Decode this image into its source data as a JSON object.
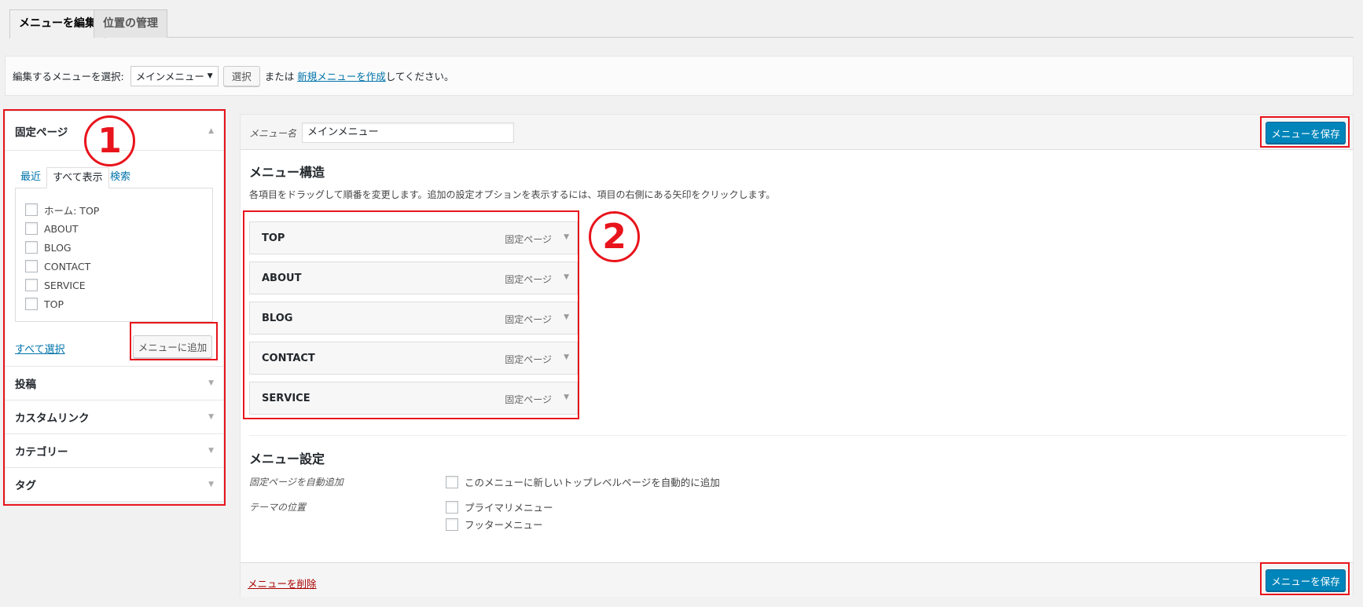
{
  "tabs": [
    {
      "label": "メニューを編集",
      "active": true
    },
    {
      "label": "位置の管理",
      "active": false
    }
  ],
  "manage": {
    "prompt": "編集するメニューを選択:",
    "selected_menu": "メインメニュー",
    "select_button": "選択",
    "or_text": "または",
    "create_link": "新規メニューを作成",
    "suffix": "してください。"
  },
  "left": {
    "pages_heading": "固定ページ",
    "tabs": [
      "最近",
      "すべて表示",
      "検索"
    ],
    "page_items": [
      "ホーム: TOP",
      "ABOUT",
      "BLOG",
      "CONTACT",
      "SERVICE",
      "TOP"
    ],
    "select_all": "すべて選択",
    "add_button": "メニューに追加",
    "sections": [
      "投稿",
      "カスタムリンク",
      "カテゴリー",
      "タグ"
    ]
  },
  "panel": {
    "name_label": "メニュー名",
    "name_value": "メインメニュー",
    "save_button": "メニューを保存",
    "structure_title": "メニュー構造",
    "structure_desc": "各項目をドラッグして順番を変更します。追加の設定オプションを表示するには、項目の右側にある矢印をクリックします。",
    "menu_items": [
      {
        "title": "TOP",
        "type": "固定ページ"
      },
      {
        "title": "ABOUT",
        "type": "固定ページ"
      },
      {
        "title": "BLOG",
        "type": "固定ページ"
      },
      {
        "title": "CONTACT",
        "type": "固定ページ"
      },
      {
        "title": "SERVICE",
        "type": "固定ページ"
      }
    ],
    "settings_title": "メニュー設定",
    "auto_add_label": "固定ページを自動追加",
    "auto_add_option": "このメニューに新しいトップレベルページを自動的に追加",
    "location_label": "テーマの位置",
    "locations": [
      "プライマリメニュー",
      "フッターメニュー"
    ],
    "delete_link": "メニューを削除"
  },
  "annotations": {
    "one": "1",
    "two": "2"
  },
  "colors": {
    "annotation": "#e8141c",
    "primary": "#0085ba",
    "link": "#0073aa",
    "delete": "#a00"
  }
}
